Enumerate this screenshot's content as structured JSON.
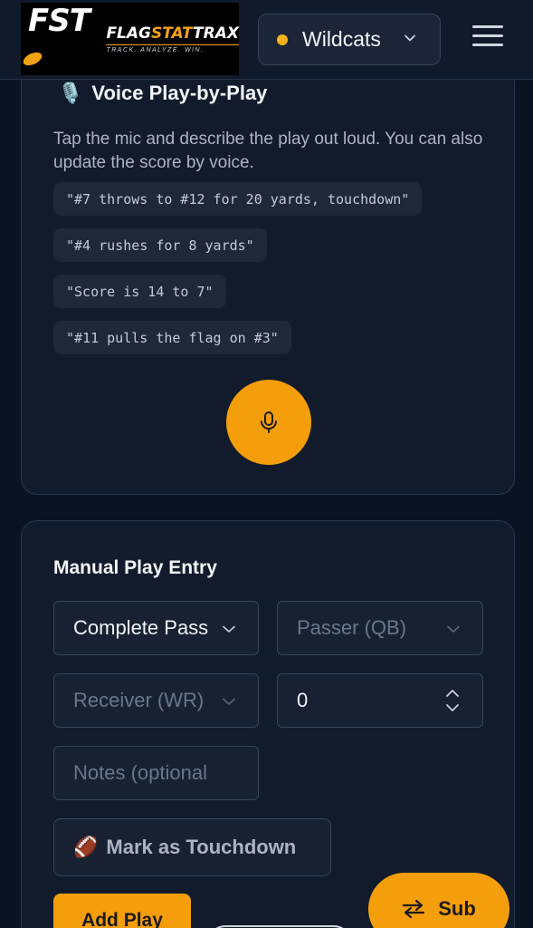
{
  "header": {
    "logo": {
      "mark": "FST",
      "name_part1": "FLAG",
      "name_part2": "STAT",
      "name_part3": "TRAX",
      "tagline": "TRACK. ANALYZE. WIN."
    },
    "team_selector": {
      "value": "Wildcats",
      "status_color": "#f2b21c"
    },
    "menu_icon": "hamburger-icon"
  },
  "voice": {
    "title": "Voice Play-by-Play",
    "title_icon": "🎙️",
    "description": "Tap the mic and describe the play out loud. You can also update the score by voice.",
    "examples": [
      "\"#7 throws to #12 for 20 yards, touchdown\"",
      "\"#4 rushes for 8 yards\"",
      "\"Score is 14 to 7\"",
      "\"#11 pulls the flag on #3\""
    ],
    "mic_icon": "microphone-icon"
  },
  "manual": {
    "title": "Manual Play Entry",
    "play_type": "Complete Pass",
    "passer_placeholder": "Passer (QB)",
    "receiver_placeholder": "Receiver (WR)",
    "yards_value": "0",
    "notes_placeholder": "Notes (optional",
    "touchdown_icon": "🏈",
    "touchdown_label": "Mark as Touchdown",
    "add_label": "Add Play"
  },
  "fab": {
    "label": "Sub",
    "icon": "swap-arrows-icon"
  },
  "colors": {
    "accent": "#f59e0b",
    "background": "#0a1322",
    "card": "#111b2b"
  }
}
